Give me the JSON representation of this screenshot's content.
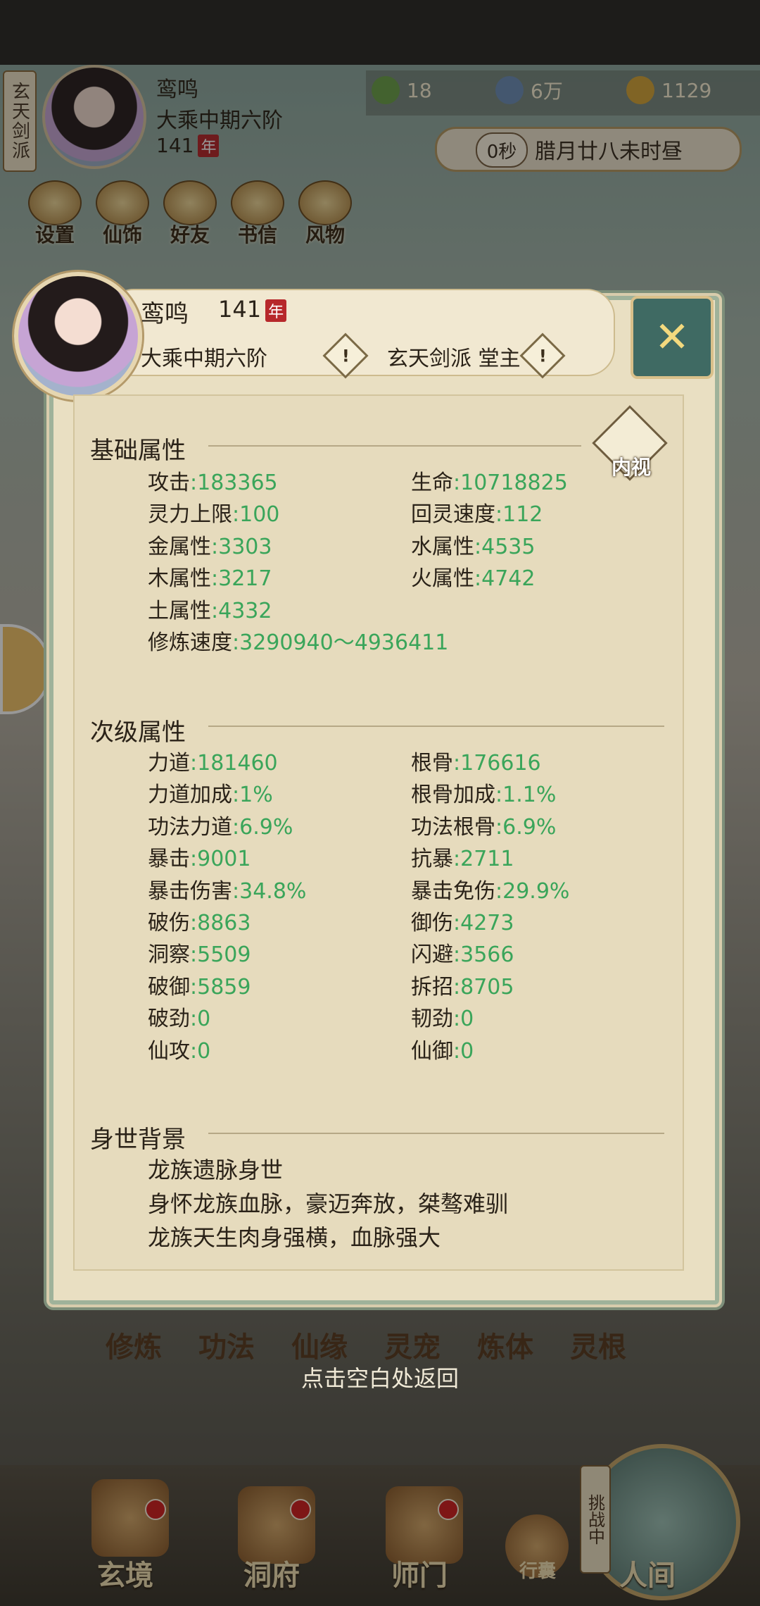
{
  "hud": {
    "sect_short": "玄天剑派",
    "name": "鸾鸣",
    "realm": "大乘中期六阶",
    "age": "141",
    "age_unit": "年",
    "resources": [
      {
        "icon": "jade-leaf-icon",
        "value": "18"
      },
      {
        "icon": "coin-icon",
        "value": "6万"
      },
      {
        "icon": "gold-ingot-icon",
        "value": "1129"
      }
    ],
    "timer": "0秒",
    "date": "腊月廿八未时昼",
    "menu": [
      "设置",
      "仙饰",
      "好友",
      "书信",
      "风物"
    ]
  },
  "panel": {
    "name": "鸾鸣",
    "age": "141",
    "age_unit": "年",
    "realm": "大乘中期六阶",
    "sect": "玄天剑派 堂主",
    "inspect_label": "内视",
    "close_symbol": "✕",
    "basic": {
      "title": "基础属性",
      "left": [
        {
          "k": "攻击",
          "v": "183365"
        },
        {
          "k": "灵力上限",
          "v": "100"
        },
        {
          "k": "金属性",
          "v": "3303"
        },
        {
          "k": "木属性",
          "v": "3217"
        },
        {
          "k": "土属性",
          "v": "4332"
        },
        {
          "k": "修炼速度",
          "v": "3290940～4936411"
        }
      ],
      "right": [
        {
          "k": "生命",
          "v": "10718825"
        },
        {
          "k": "回灵速度",
          "v": "112"
        },
        {
          "k": "水属性",
          "v": "4535"
        },
        {
          "k": "火属性",
          "v": "4742"
        }
      ]
    },
    "secondary": {
      "title": "次级属性",
      "left": [
        {
          "k": "力道",
          "v": "181460"
        },
        {
          "k": "力道加成",
          "v": "1%"
        },
        {
          "k": "功法力道",
          "v": "6.9%"
        },
        {
          "k": "暴击",
          "v": "9001"
        },
        {
          "k": "暴击伤害",
          "v": "34.8%"
        },
        {
          "k": "破伤",
          "v": "8863"
        },
        {
          "k": "洞察",
          "v": "5509"
        },
        {
          "k": "破御",
          "v": "5859"
        },
        {
          "k": "破劲",
          "v": "0"
        },
        {
          "k": "仙攻",
          "v": "0"
        }
      ],
      "right": [
        {
          "k": "根骨",
          "v": "176616"
        },
        {
          "k": "根骨加成",
          "v": "1.1%"
        },
        {
          "k": "功法根骨",
          "v": "6.9%"
        },
        {
          "k": "抗暴",
          "v": "2711"
        },
        {
          "k": "暴击免伤",
          "v": "29.9%"
        },
        {
          "k": "御伤",
          "v": "4273"
        },
        {
          "k": "闪避",
          "v": "3566"
        },
        {
          "k": "拆招",
          "v": "8705"
        },
        {
          "k": "韧劲",
          "v": "0"
        },
        {
          "k": "仙御",
          "v": "0"
        }
      ]
    },
    "background": {
      "title": "身世背景",
      "lines": [
        "龙族遗脉身世",
        "身怀龙族血脉，豪迈奔放，桀骜难驯",
        "龙族天生肉身强横，血脉强大"
      ]
    }
  },
  "lower_tabs": [
    "修炼",
    "功法",
    "仙缘",
    "灵宠",
    "炼体",
    "灵根"
  ],
  "back_hint": "点击空白处返回",
  "bottom_nav": [
    {
      "label": "玄境",
      "icon": "scroll-icon"
    },
    {
      "label": "洞府",
      "icon": "pavilion-icon"
    },
    {
      "label": "师门",
      "icon": "banner-icon"
    },
    {
      "label": "行囊",
      "icon": "bag-icon"
    },
    {
      "label": "人间",
      "icon": "world-icon"
    }
  ],
  "challenge_label": "挑战中",
  "colors": {
    "stat_value": "#3aa55a",
    "panel_bg": "#e9dfc2",
    "close_bg": "#3f6a63"
  }
}
